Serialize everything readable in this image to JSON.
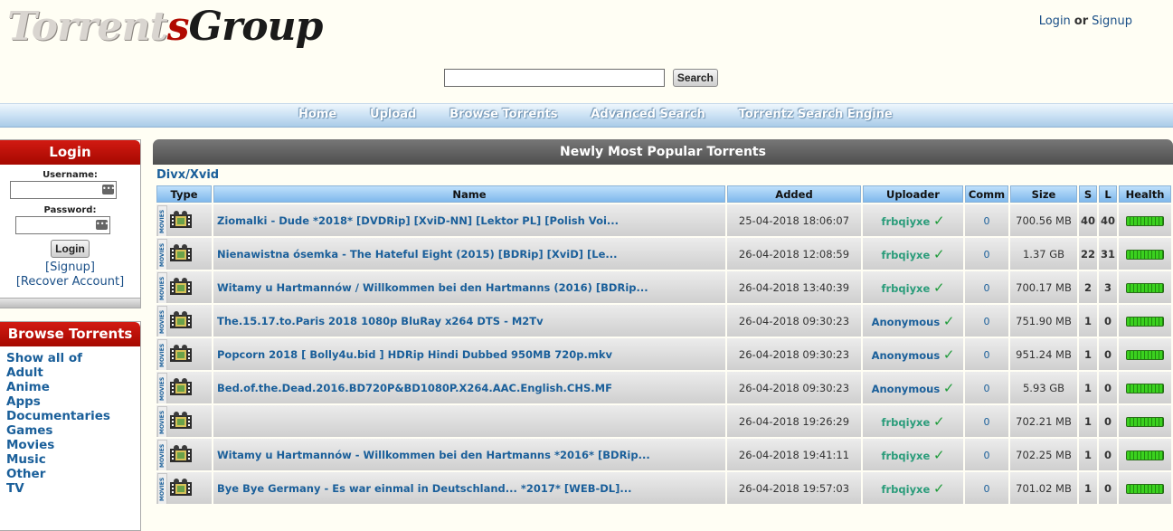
{
  "logo": {
    "part1": "Torrent",
    "part2": "s",
    "part3": "Group"
  },
  "auth": {
    "login": "Login",
    "or": "or",
    "signup": "Signup"
  },
  "search": {
    "value": "",
    "button": "Search"
  },
  "nav": [
    "Home",
    "Upload",
    "Browse Torrents",
    "Advanced Search",
    "Torrentz Search Engine"
  ],
  "login_box": {
    "title": "Login",
    "username_label": "Username:",
    "password_label": "Password:",
    "button": "Login",
    "signup_link": "[Signup]",
    "recover_link": "[Recover Account]"
  },
  "browse_box": {
    "title": "Browse Torrents",
    "items": [
      "Show all of",
      "Adult",
      "Anime",
      "Apps",
      "Documentaries",
      "Games",
      "Movies",
      "Music",
      "Other",
      "TV"
    ]
  },
  "main": {
    "title": "Newly Most Popular Torrents",
    "category": "Divx/Xvid",
    "columns": [
      "Type",
      "Name",
      "Added",
      "Uploader",
      "Comm",
      "Size",
      "S",
      "L",
      "Health"
    ],
    "type_label": "MOVIES",
    "rows": [
      {
        "name": "Ziomalki - Dude *2018* [DVDRip] [XviD-NN] [Lektor PL] [Polish Voi...",
        "added": "25-04-2018 18:06:07",
        "uploader": "frbqiyxe",
        "anon": false,
        "comm": "0",
        "size": "700.56 MB",
        "s": "40",
        "l": "40",
        "health": 1.0
      },
      {
        "name": "Nienawistna ósemka - The Hateful Eight (2015) [BDRip] [XviD] [Le...",
        "added": "26-04-2018 12:08:59",
        "uploader": "frbqiyxe",
        "anon": false,
        "comm": "0",
        "size": "1.37 GB",
        "s": "22",
        "l": "31",
        "health": 1.0
      },
      {
        "name": "Witamy u Hartmannów / Willkommen bei den Hartmanns (2016) [BDRip...",
        "added": "26-04-2018 13:40:39",
        "uploader": "frbqiyxe",
        "anon": false,
        "comm": "0",
        "size": "700.17 MB",
        "s": "2",
        "l": "3",
        "health": 1.0
      },
      {
        "name": "The.15.17.to.Paris 2018 1080p BluRay x264 DTS - M2Tv",
        "added": "26-04-2018 09:30:23",
        "uploader": "Anonymous",
        "anon": true,
        "comm": "0",
        "size": "751.90 MB",
        "s": "1",
        "l": "0",
        "health": 1.0
      },
      {
        "name": "Popcorn 2018 [ Bolly4u.bid ] HDRip Hindi Dubbed 950MB 720p.mkv",
        "added": "26-04-2018 09:30:23",
        "uploader": "Anonymous",
        "anon": true,
        "comm": "0",
        "size": "951.24 MB",
        "s": "1",
        "l": "0",
        "health": 1.0
      },
      {
        "name": "Bed.of.the.Dead.2016.BD720P&BD1080P.X264.AAC.English.CHS.MF",
        "added": "26-04-2018 09:30:23",
        "uploader": "Anonymous",
        "anon": true,
        "comm": "0",
        "size": "5.93 GB",
        "s": "1",
        "l": "0",
        "health": 1.0
      },
      {
        "name": "",
        "added": "26-04-2018 19:26:29",
        "uploader": "frbqiyxe",
        "anon": false,
        "comm": "0",
        "size": "702.21 MB",
        "s": "1",
        "l": "0",
        "health": 1.0
      },
      {
        "name": "Witamy u Hartmannów - Willkommen bei den Hartmanns *2016* [BDRip...",
        "added": "26-04-2018 19:41:11",
        "uploader": "frbqiyxe",
        "anon": false,
        "comm": "0",
        "size": "702.25 MB",
        "s": "1",
        "l": "0",
        "health": 1.0
      },
      {
        "name": "Bye Bye Germany - Es war einmal in Deutschland... *2017* [WEB-DL]...",
        "added": "26-04-2018 19:57:03",
        "uploader": "frbqiyxe",
        "anon": false,
        "comm": "0",
        "size": "701.02 MB",
        "s": "1",
        "l": "0",
        "health": 1.0
      }
    ]
  }
}
